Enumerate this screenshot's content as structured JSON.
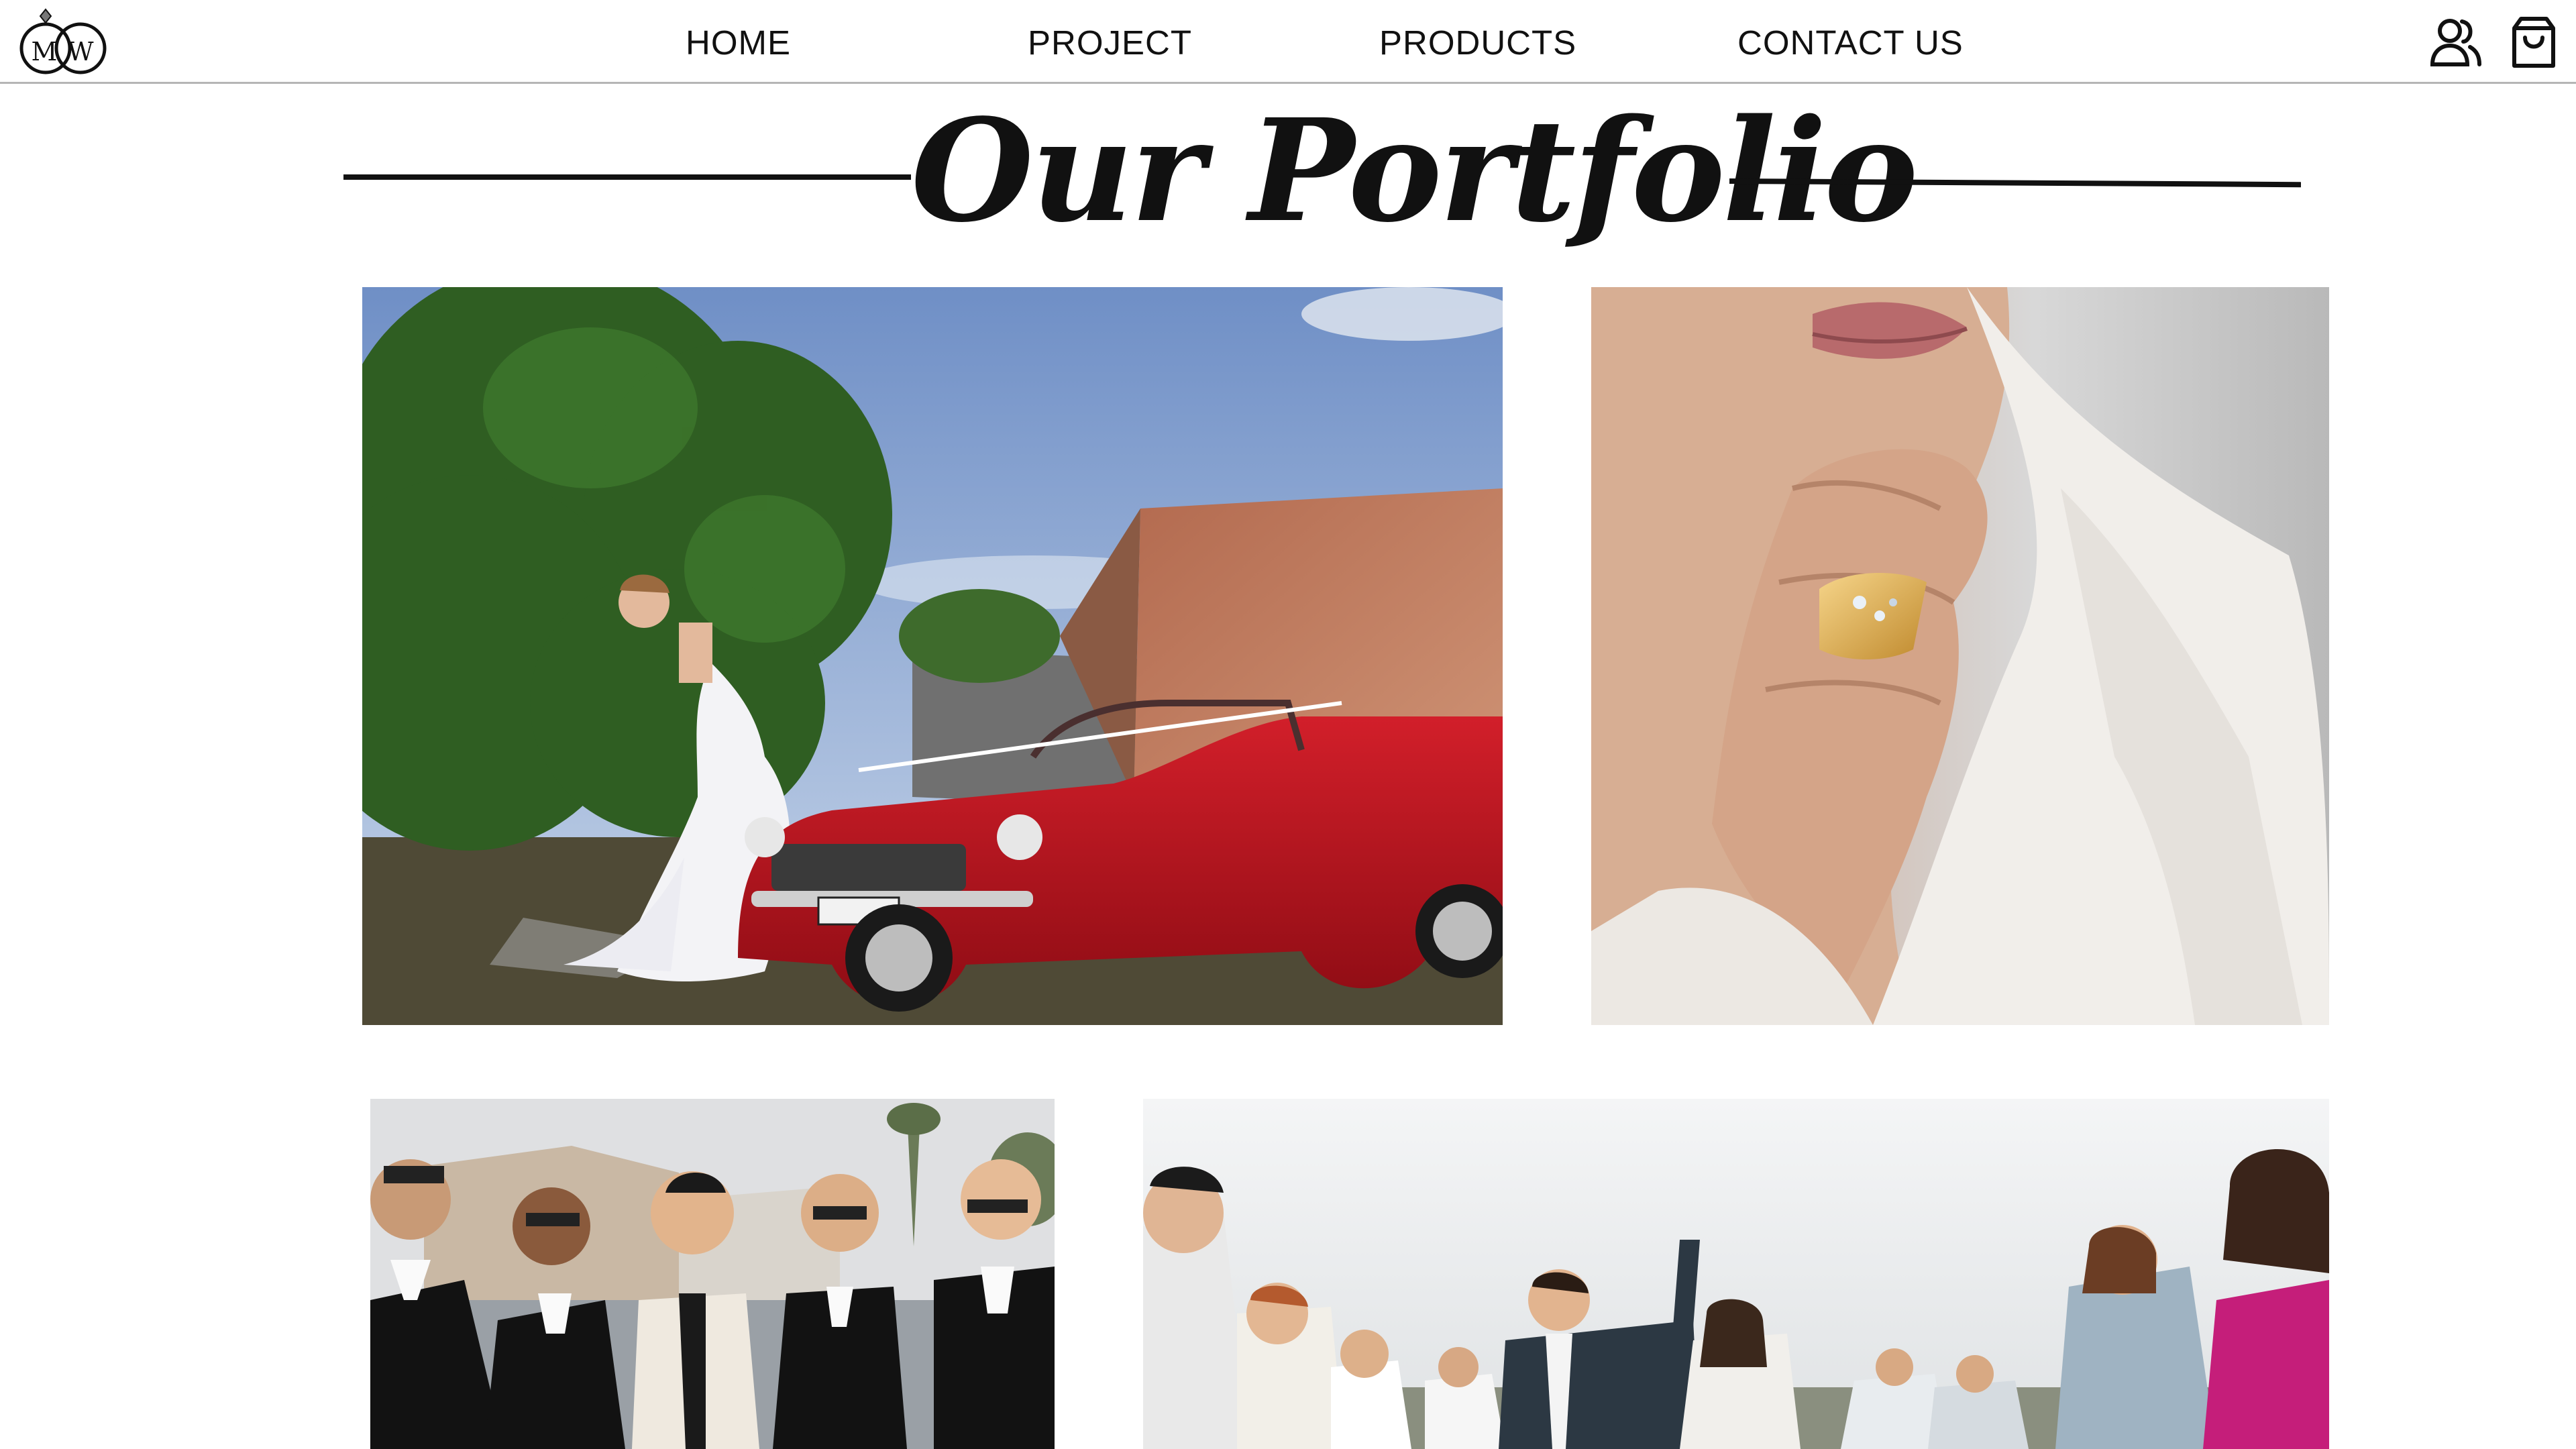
{
  "brand": {
    "logo_initial_left": "M",
    "logo_initial_right": "W"
  },
  "nav": {
    "items": [
      {
        "label": "HOME"
      },
      {
        "label": "PROJECT"
      },
      {
        "label": "PRODUCTS"
      },
      {
        "label": "CONTACT US"
      }
    ]
  },
  "header_icons": {
    "account": "user-icon",
    "cart": "shopping-bag-icon"
  },
  "portfolio": {
    "title": "Our Portfolio",
    "photos": [
      {
        "subject": "bride-with-red-convertible"
      },
      {
        "subject": "hand-with-gold-ring"
      },
      {
        "subject": "groomsmen-in-tuxedos"
      },
      {
        "subject": "wedding-celebration-crowd"
      }
    ]
  },
  "colors": {
    "text": "#111111",
    "header_border": "#b5b5b5",
    "background": "#ffffff"
  }
}
